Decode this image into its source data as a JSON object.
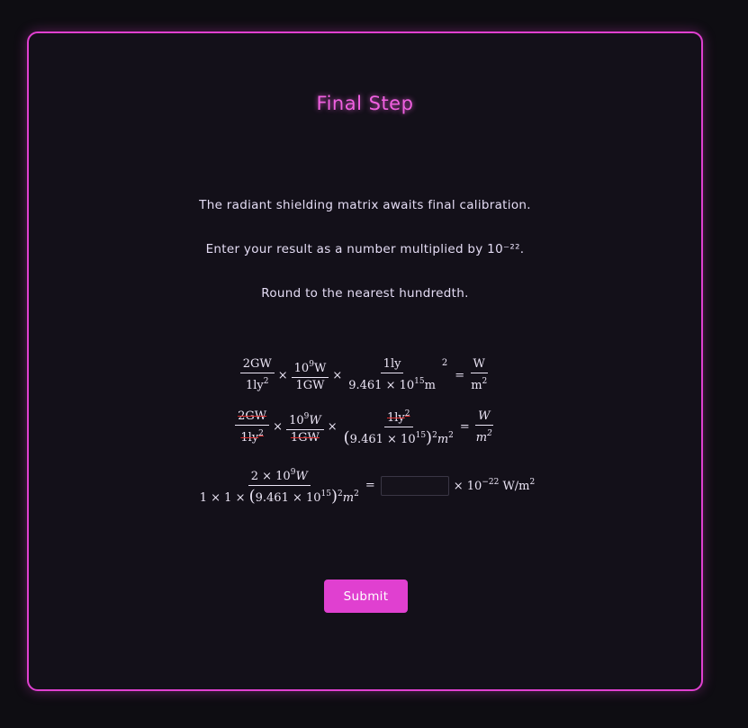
{
  "card": {
    "title": "Final Step",
    "instructions": [
      "The radiant shielding matrix awaits final calibration.",
      "Enter your result as a number multiplied by 10⁻²².",
      "Round to the nearest hundredth."
    ]
  },
  "equation1": {
    "f1_num": "2GW",
    "f1_den": "1ly",
    "f1_den_exp": "2",
    "times": "×",
    "f2_num_base": "10",
    "f2_num_exp": "9",
    "f2_num_unit": "W",
    "f2_den": "1GW",
    "f3_num": "1ly",
    "f3_den_pre": "9.461 × 10",
    "f3_den_exp": "15",
    "f3_den_unit": "m",
    "outer_exp": "2",
    "equals": "=",
    "res_num": "W",
    "res_den": "m",
    "res_den_exp": "2"
  },
  "equation2": {
    "f1_num": "2GW",
    "f1_den": "1ly",
    "f1_den_exp": "2",
    "f2_num_base": "10",
    "f2_num_exp": "9",
    "f2_num_unit": "W",
    "f2_den": "1GW",
    "f3_num": "1ly",
    "f3_num_exp": "2",
    "f3_den_pre": "9.461 × 10",
    "f3_den_exp": "15",
    "f3_den_paren_exp": "2",
    "f3_den_unit": "m",
    "f3_den_unit_exp": "2",
    "res_num": "W",
    "res_den": "m",
    "res_den_exp": "2"
  },
  "equation3": {
    "num_pre": "2 × 10",
    "num_exp": "9",
    "num_unit": "W",
    "den_pre": "1 × 1 × ",
    "den_inner": "9.461 × 10",
    "den_inner_exp": "15",
    "den_paren_exp": "2",
    "den_unit": "m",
    "den_unit_exp": "2",
    "answer_value": "",
    "suffix_pre": "× 10",
    "suffix_exp": "−22",
    "suffix_unit": " W/m",
    "suffix_unit_exp": "2"
  },
  "submit_label": "Submit",
  "colors": {
    "accent": "#e040d0",
    "background": "#0e0d12",
    "card": "#131019",
    "text": "#e4dcf4",
    "cancel_strike": "#e03030"
  }
}
